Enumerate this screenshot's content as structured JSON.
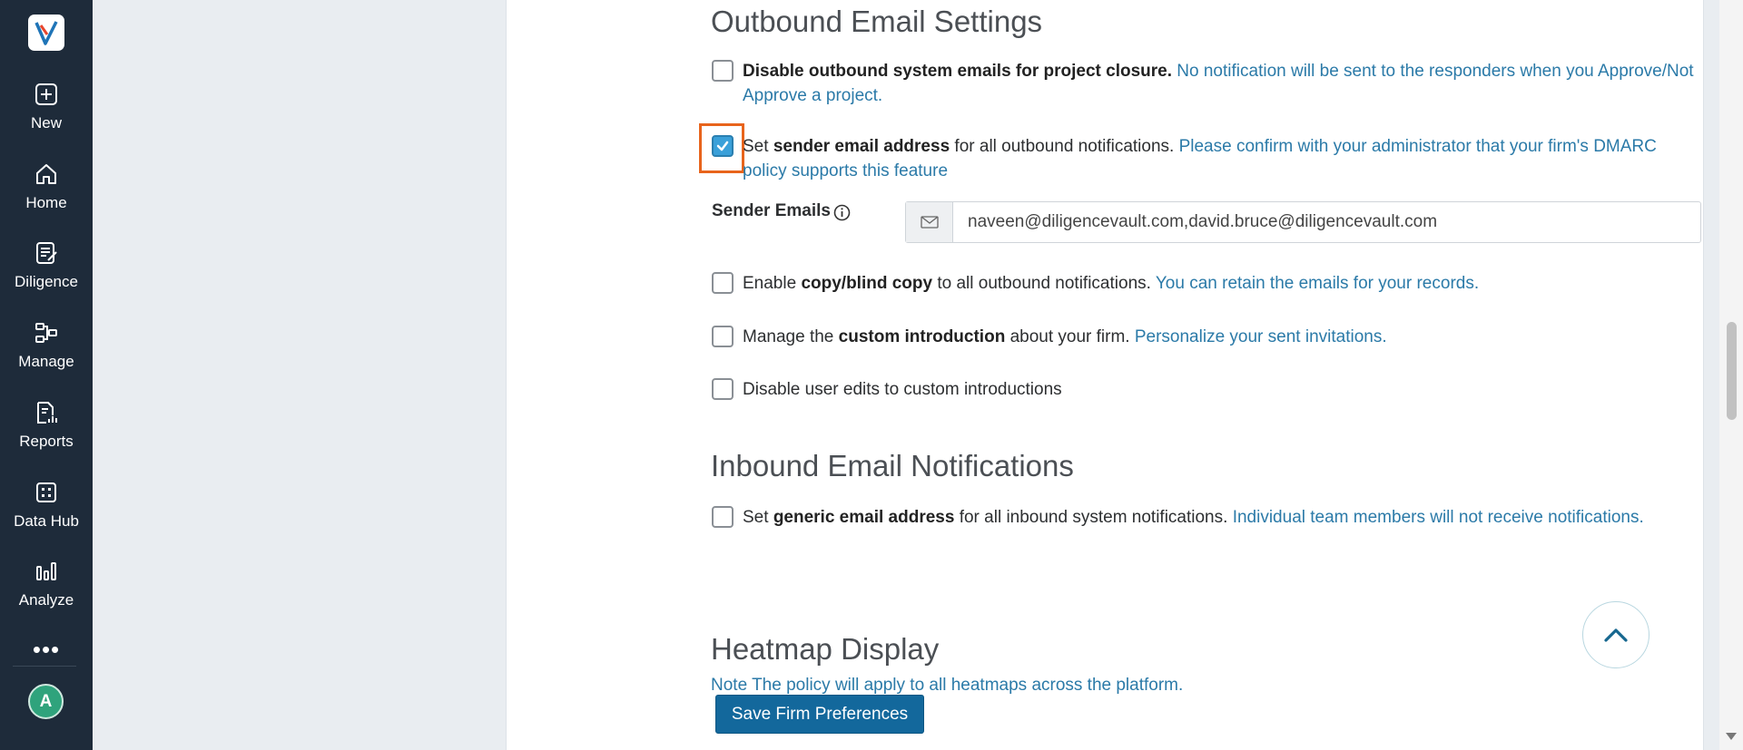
{
  "sidebar": {
    "logo_icon": "app-logo-icon",
    "items": [
      {
        "label": "New",
        "icon": "plus-square-icon"
      },
      {
        "label": "Home",
        "icon": "home-icon"
      },
      {
        "label": "Diligence",
        "icon": "diligence-icon"
      },
      {
        "label": "Manage",
        "icon": "manage-icon"
      },
      {
        "label": "Reports",
        "icon": "reports-icon"
      },
      {
        "label": "Data Hub",
        "icon": "data-hub-icon"
      },
      {
        "label": "Analyze",
        "icon": "analyze-icon"
      }
    ],
    "more": "•••",
    "avatar_initial": "A",
    "colors": {
      "background": "#1e2b3a",
      "avatar": "#2fa37c"
    }
  },
  "outbound": {
    "title": "Outbound Email Settings",
    "options": [
      {
        "checked": false,
        "bold": "Disable outbound system emails for project closure.",
        "note": "No notification will be sent to the responders when you Approve/Not Approve a project."
      },
      {
        "checked": true,
        "pre": "Set ",
        "bold": "sender email address",
        "post": " for all outbound notifications.",
        "note": "Please confirm with your administrator that your firm's DMARC policy supports this feature"
      },
      {
        "checked": false,
        "pre": "Enable ",
        "bold": "copy/blind copy",
        "post": " to all outbound notifications.",
        "note": "You can retain the emails for your records."
      },
      {
        "checked": false,
        "pre": "Manage the ",
        "bold": "custom introduction",
        "post": " about your firm.",
        "note": "Personalize your sent invitations."
      },
      {
        "checked": false,
        "pre": "Disable user edits to custom introductions"
      }
    ],
    "sender_emails": {
      "label": "Sender Emails",
      "value": "naveen@diligencevault.com,david.bruce@diligencevault.com",
      "icon": "envelope-icon"
    }
  },
  "inbound": {
    "title": "Inbound Email Notifications",
    "option": {
      "checked": false,
      "pre": "Set ",
      "bold": "generic email address",
      "post": " for all inbound system notifications.",
      "note": "Individual team members will not receive notifications."
    }
  },
  "heatmap": {
    "title": "Heatmap Display",
    "note": "Note The policy will apply to all heatmaps across the platform."
  },
  "save_button": "Save Firm Preferences",
  "colors": {
    "accent": "#13689c",
    "note_text": "#2b7aa8",
    "checkbox_checked": "#3aa0d9",
    "focus": "#e8641c"
  }
}
